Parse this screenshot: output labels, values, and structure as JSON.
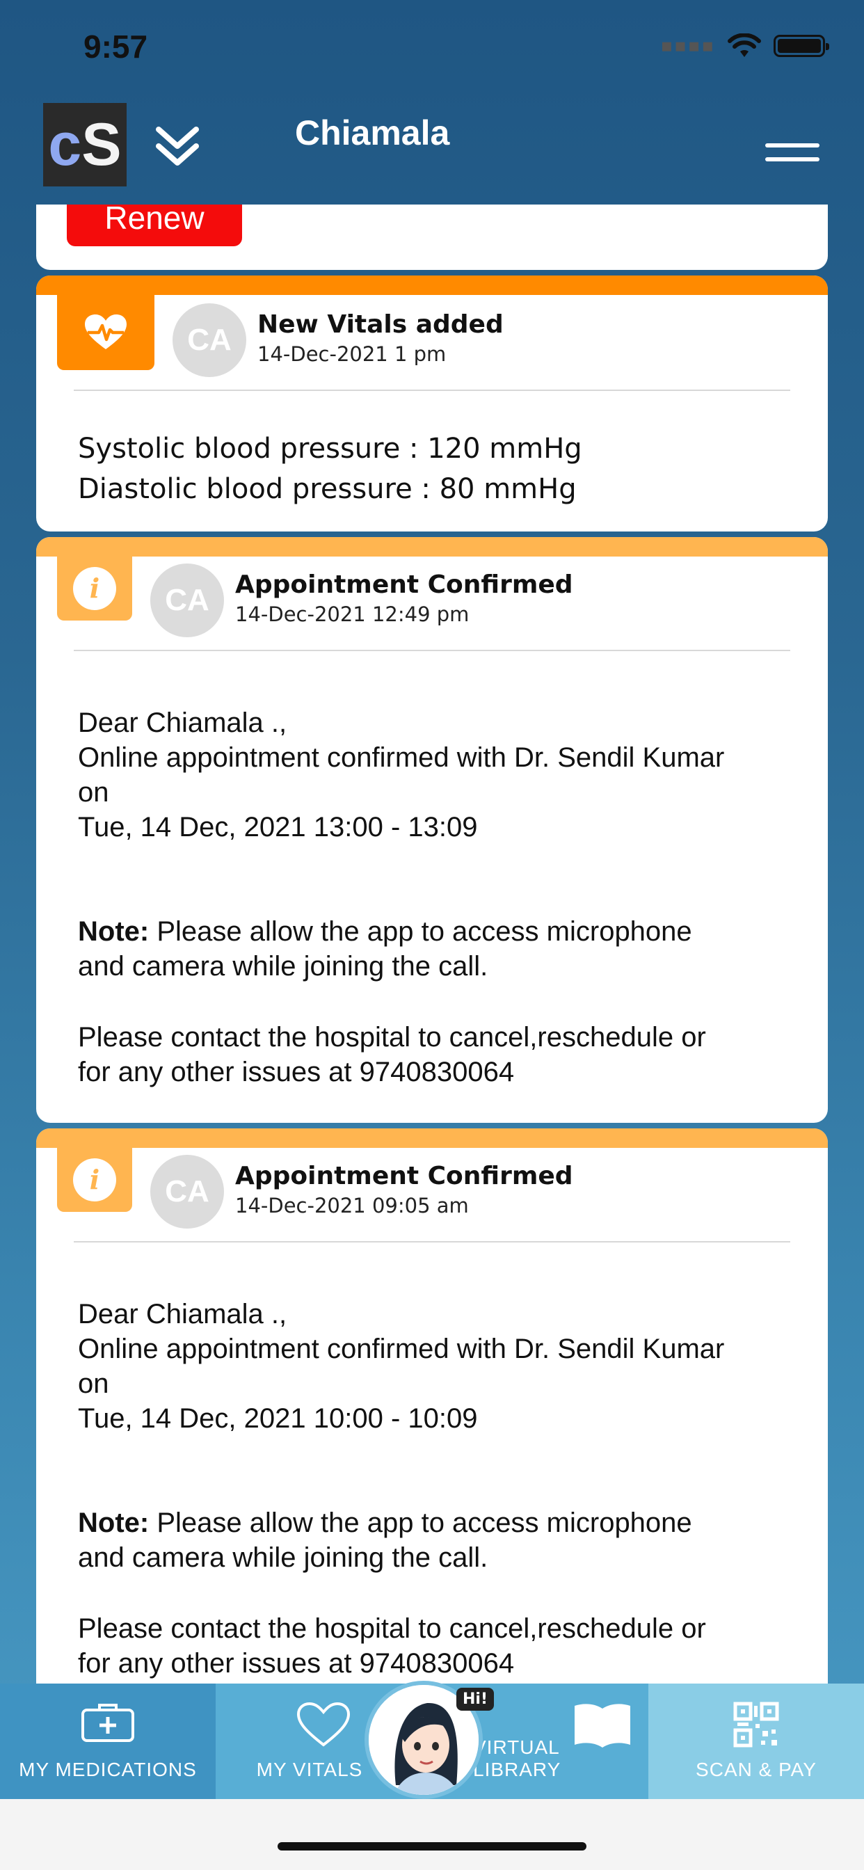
{
  "status_bar": {
    "time": "9:57"
  },
  "header": {
    "logo_c": "c",
    "logo_s": "S",
    "title": "Chiamala"
  },
  "renew_card": {
    "button_label": "Renew"
  },
  "vitals_card": {
    "avatar": "CA",
    "title": "New Vitals added",
    "date": "14-Dec-2021 1 pm",
    "lines": [
      "Systolic blood pressure : 120 mmHg",
      "Diastolic blood pressure : 80 mmHg"
    ],
    "accent": "#ff8a00"
  },
  "appointments": [
    {
      "avatar": "CA",
      "title": "Appointment Confirmed",
      "date": "14-Dec-2021 12:49 pm",
      "greeting": " Dear Chiamala .,",
      "line1": "Online appointment confirmed with Dr. Sendil Kumar",
      "line2": "on",
      "slot": "Tue, 14 Dec, 2021 13:00 - 13:09",
      "note_label": "Note:",
      "note_text": "  Please allow the app to access microphone",
      "note_text2": "and camera while joining the call.",
      "contact1": " Please contact the hospital to cancel,reschedule or",
      "contact2": "for any other issues at 9740830064"
    },
    {
      "avatar": "CA",
      "title": "Appointment Confirmed",
      "date": "14-Dec-2021 09:05 am",
      "greeting": " Dear Chiamala .,",
      "line1": "Online appointment confirmed with Dr. Sendil Kumar",
      "line2": "on",
      "slot": "Tue, 14 Dec, 2021 10:00 - 10:09",
      "note_label": "Note:",
      "note_text": "  Please allow the app to access microphone",
      "note_text2": "and camera while joining the call.",
      "contact1": " Please contact the hospital to cancel,reschedule or",
      "contact2": "for any other issues at 9740830064"
    }
  ],
  "info_accent": "#ffb550",
  "tabbar": {
    "items": [
      {
        "label": "MY MEDICATIONS",
        "icon": "first-aid-kit-icon",
        "bg": "#3f93c2"
      },
      {
        "label": "MY VITALS",
        "icon": "heart-icon",
        "bg": "#58aed5"
      },
      {
        "label": "VIRTUAL LIBRARY",
        "icon": "book-icon",
        "bg": "#58aed5"
      },
      {
        "label": "SCAN & PAY",
        "icon": "qr-code-icon",
        "bg": "#8acde6"
      }
    ],
    "assistant_badge": "Hi!"
  }
}
